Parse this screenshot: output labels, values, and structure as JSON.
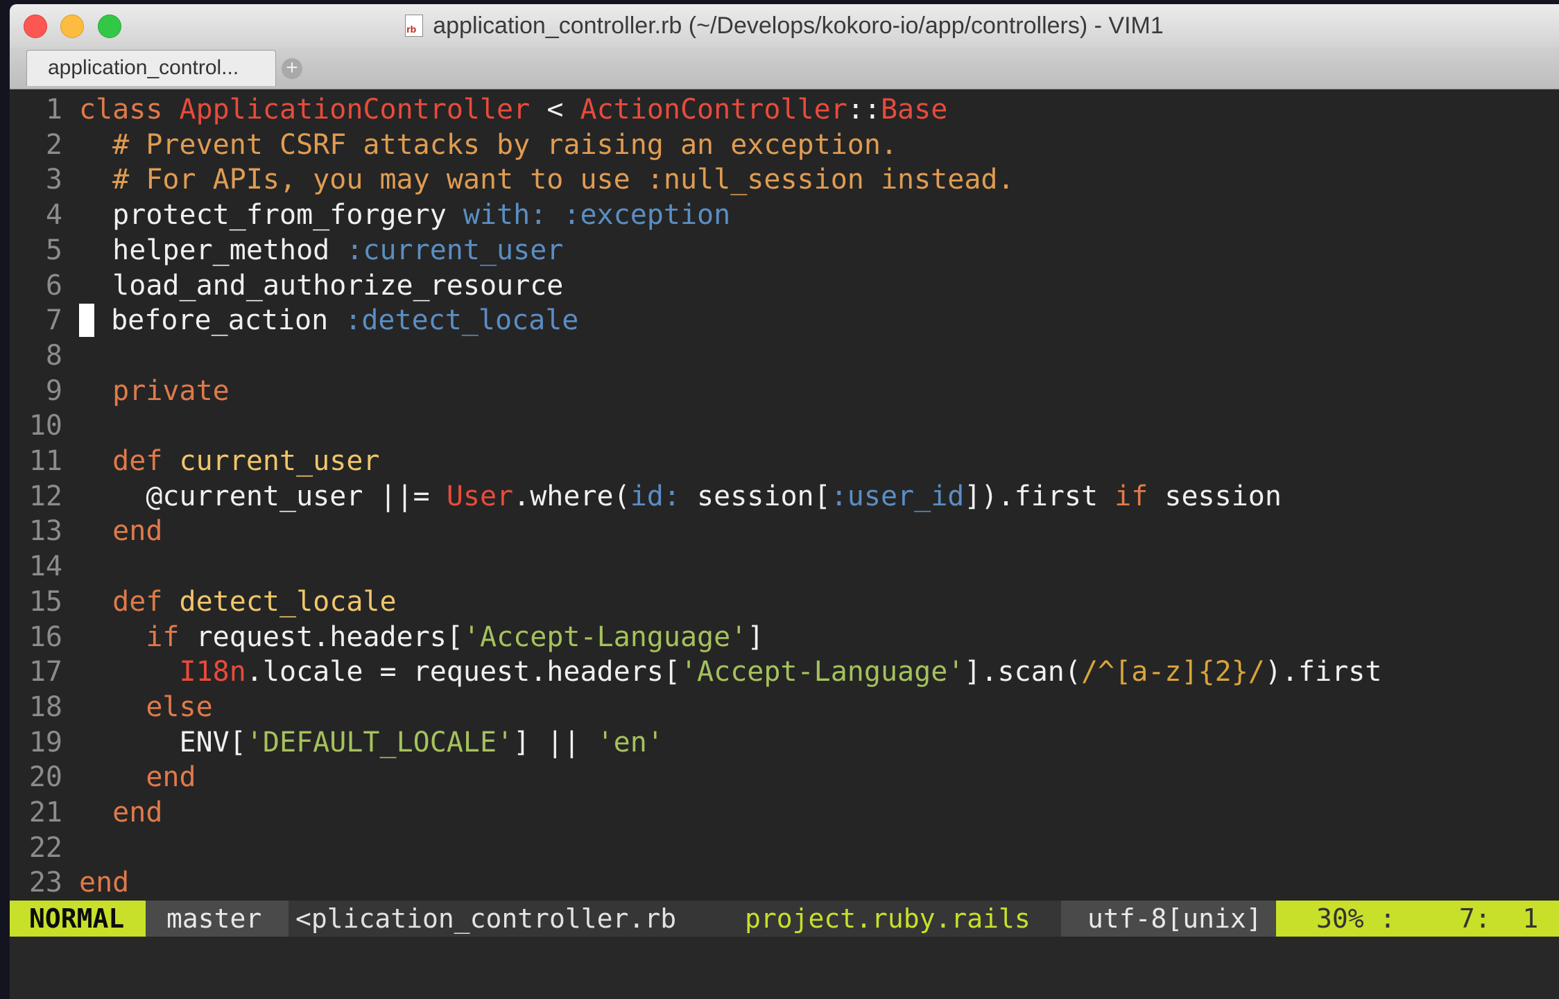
{
  "window": {
    "title": "application_controller.rb (~/Develops/kokoro-io/app/controllers) - VIM1",
    "file_icon": "rb"
  },
  "tabs": [
    {
      "label": "application_control..."
    }
  ],
  "code_lines": [
    {
      "n": "1",
      "tokens": [
        {
          "t": "class ",
          "c": "kw"
        },
        {
          "t": "ApplicationController",
          "c": "cls"
        },
        {
          "t": " < ",
          "c": ""
        },
        {
          "t": "ActionController",
          "c": "cls"
        },
        {
          "t": "::",
          "c": ""
        },
        {
          "t": "Base",
          "c": "cls"
        }
      ]
    },
    {
      "n": "2",
      "tokens": [
        {
          "t": "  # Prevent CSRF attacks by raising an exception.",
          "c": "cmt"
        }
      ]
    },
    {
      "n": "3",
      "tokens": [
        {
          "t": "  # For APIs, you may want to use :null_session instead.",
          "c": "cmt"
        }
      ]
    },
    {
      "n": "4",
      "tokens": [
        {
          "t": "  protect_from_forgery ",
          "c": ""
        },
        {
          "t": "with: :exception",
          "c": "sym"
        }
      ]
    },
    {
      "n": "5",
      "tokens": [
        {
          "t": "  helper_method ",
          "c": ""
        },
        {
          "t": ":current_user",
          "c": "sym"
        }
      ]
    },
    {
      "n": "6",
      "tokens": [
        {
          "t": "  load_and_authorize_resource",
          "c": ""
        }
      ]
    },
    {
      "n": "7",
      "cursor": true,
      "tokens": [
        {
          "t": " before_action ",
          "c": ""
        },
        {
          "t": ":detect_locale",
          "c": "sym"
        }
      ]
    },
    {
      "n": "8",
      "tokens": []
    },
    {
      "n": "9",
      "tokens": [
        {
          "t": "  private",
          "c": "kw"
        }
      ]
    },
    {
      "n": "10",
      "tokens": []
    },
    {
      "n": "11",
      "tokens": [
        {
          "t": "  def ",
          "c": "kw"
        },
        {
          "t": "current_user",
          "c": "fn"
        }
      ]
    },
    {
      "n": "12",
      "tokens": [
        {
          "t": "    @current_user ||= ",
          "c": ""
        },
        {
          "t": "User",
          "c": "cls"
        },
        {
          "t": ".where(",
          "c": ""
        },
        {
          "t": "id:",
          "c": "sym"
        },
        {
          "t": " session[",
          "c": ""
        },
        {
          "t": ":user_id",
          "c": "sym"
        },
        {
          "t": "]).first ",
          "c": ""
        },
        {
          "t": "if",
          "c": "kw"
        },
        {
          "t": " session",
          "c": ""
        }
      ]
    },
    {
      "n": "13",
      "tokens": [
        {
          "t": "  end",
          "c": "kw"
        }
      ]
    },
    {
      "n": "14",
      "tokens": []
    },
    {
      "n": "15",
      "tokens": [
        {
          "t": "  def ",
          "c": "kw"
        },
        {
          "t": "detect_locale",
          "c": "fn"
        }
      ]
    },
    {
      "n": "16",
      "tokens": [
        {
          "t": "    if",
          "c": "kw"
        },
        {
          "t": " request.headers[",
          "c": ""
        },
        {
          "t": "'Accept-Language'",
          "c": "str"
        },
        {
          "t": "]",
          "c": ""
        }
      ]
    },
    {
      "n": "17",
      "tokens": [
        {
          "t": "      ",
          "c": ""
        },
        {
          "t": "I18n",
          "c": "cls"
        },
        {
          "t": ".locale = request.headers[",
          "c": ""
        },
        {
          "t": "'Accept-Language'",
          "c": "str"
        },
        {
          "t": "].scan(",
          "c": ""
        },
        {
          "t": "/^[a-z]{2}/",
          "c": "reg"
        },
        {
          "t": ").first",
          "c": ""
        }
      ]
    },
    {
      "n": "18",
      "tokens": [
        {
          "t": "    else",
          "c": "kw"
        }
      ]
    },
    {
      "n": "19",
      "tokens": [
        {
          "t": "      ENV[",
          "c": ""
        },
        {
          "t": "'DEFAULT_LOCALE'",
          "c": "str"
        },
        {
          "t": "] || ",
          "c": ""
        },
        {
          "t": "'en'",
          "c": "str"
        }
      ]
    },
    {
      "n": "20",
      "tokens": [
        {
          "t": "    end",
          "c": "kw"
        }
      ]
    },
    {
      "n": "21",
      "tokens": [
        {
          "t": "  end",
          "c": "kw"
        }
      ]
    },
    {
      "n": "22",
      "tokens": []
    },
    {
      "n": "23",
      "tokens": [
        {
          "t": "end",
          "c": "kw"
        }
      ]
    }
  ],
  "status": {
    "mode": "NORMAL",
    "branch": "master",
    "filename": "<plication_controller.rb",
    "filetype": "project.ruby.rails",
    "encoding": "utf-8[unix]",
    "position": "30% :    7:  1"
  },
  "colors": {
    "background": "#252525",
    "statusline_accent": "#c8e02a",
    "keyword": "#e07a4a",
    "class": "#e84b3c",
    "symbol": "#5a8ec4",
    "string": "#a5c25c",
    "comment": "#e09c52"
  }
}
